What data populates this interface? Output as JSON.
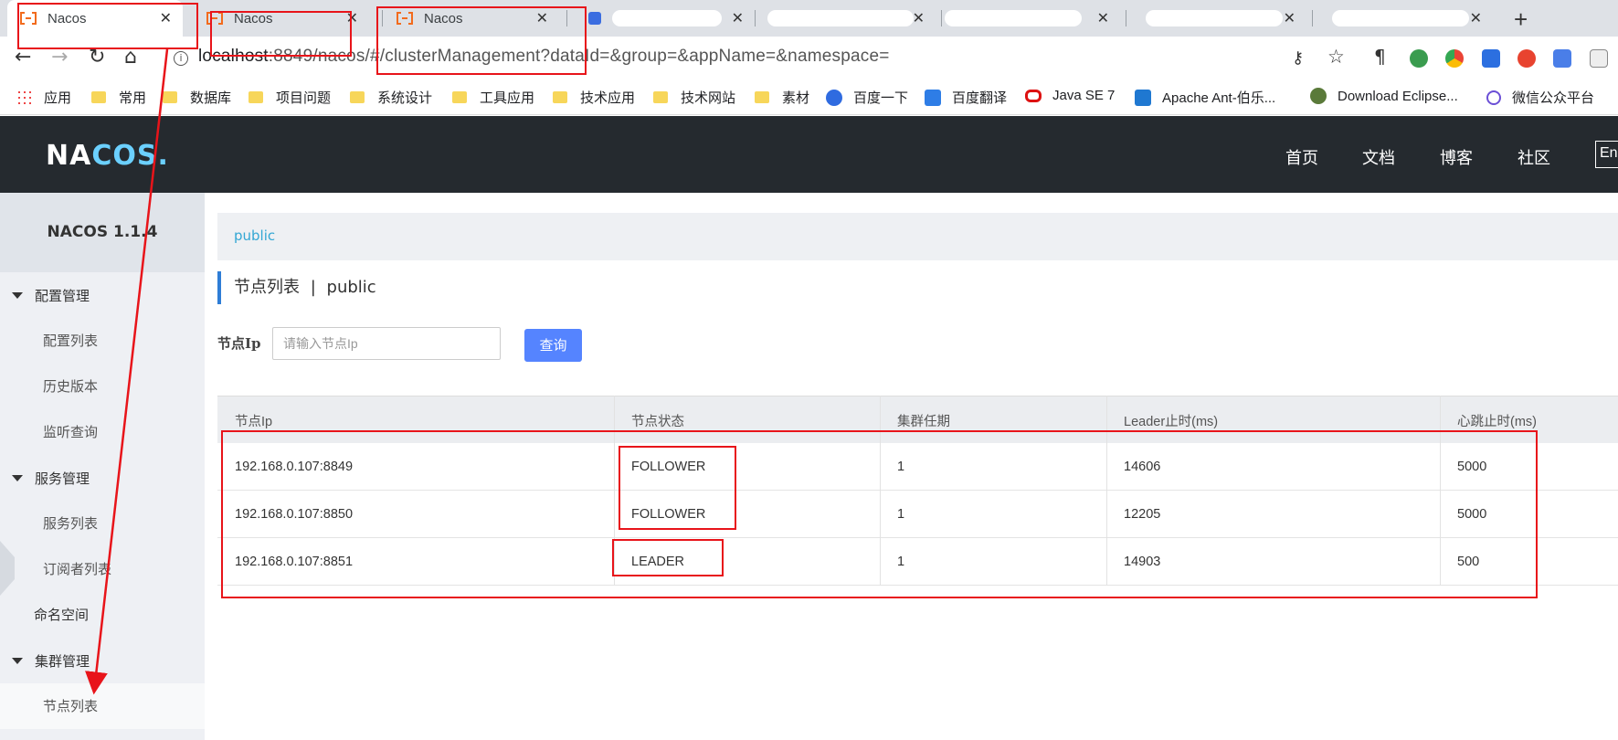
{
  "browser": {
    "tabs": [
      {
        "title": "Nacos",
        "close": "✕"
      },
      {
        "title": "Nacos",
        "close": "✕"
      },
      {
        "title": "Nacos",
        "close": "✕"
      }
    ],
    "new_tab": "+",
    "url_host": "localhost",
    "url_rest": ":8849/nacos/#/clusterManagement?dataId=&group=&appName=&namespace="
  },
  "bookmarks": [
    {
      "label": "应用",
      "icon": "apps-grid-icon"
    },
    {
      "label": "常用",
      "icon": "folder-icon"
    },
    {
      "label": "数据库",
      "icon": "folder-icon"
    },
    {
      "label": "项目问题",
      "icon": "folder-icon"
    },
    {
      "label": "系统设计",
      "icon": "folder-icon"
    },
    {
      "label": "工具应用",
      "icon": "folder-icon"
    },
    {
      "label": "技术应用",
      "icon": "folder-icon"
    },
    {
      "label": "技术网站",
      "icon": "folder-icon"
    },
    {
      "label": "素材",
      "icon": "folder-icon"
    },
    {
      "label": "百度一下",
      "icon": "baidu-icon"
    },
    {
      "label": "百度翻译",
      "icon": "translate-icon"
    },
    {
      "label": "Java SE 7",
      "icon": "oracle-icon"
    },
    {
      "label": "Apache Ant-伯乐...",
      "icon": "blog-icon"
    },
    {
      "label": "Download Eclipse...",
      "icon": "eclipse-icon"
    },
    {
      "label": "微信公众平台",
      "icon": "wechat-icon"
    }
  ],
  "header": {
    "logo_a": "NA",
    "logo_b": "COS",
    "logo_dot": ".",
    "nav": [
      "首页",
      "文档",
      "博客",
      "社区"
    ],
    "lang": "En"
  },
  "sidebar": {
    "version": "NACOS 1.1.4",
    "groups": [
      {
        "label": "配置管理",
        "items": [
          "配置列表",
          "历史版本",
          "监听查询"
        ]
      },
      {
        "label": "服务管理",
        "items": [
          "服务列表",
          "订阅者列表"
        ]
      }
    ],
    "namespace": "命名空间",
    "cluster_group": "集群管理",
    "cluster_item": "节点列表"
  },
  "main": {
    "namespace_tab": "public",
    "title": "节点列表",
    "title_sep": "|",
    "title_ns": "public",
    "search_label": "节点Ip",
    "search_placeholder": "请输入节点Ip",
    "search_button": "查询"
  },
  "table": {
    "columns": [
      "节点Ip",
      "节点状态",
      "集群任期",
      "Leader止时(ms)",
      "心跳止时(ms)"
    ],
    "rows": [
      [
        "192.168.0.107:8849",
        "FOLLOWER",
        "1",
        "14606",
        "5000"
      ],
      [
        "192.168.0.107:8850",
        "FOLLOWER",
        "1",
        "12205",
        "5000"
      ],
      [
        "192.168.0.107:8851",
        "LEADER",
        "1",
        "14903",
        "500"
      ]
    ]
  },
  "colors": {
    "header_bg": "#252a2f",
    "accent_blue": "#5584ff",
    "annotation_red": "#e8141a",
    "namespace_link": "#33a7d4"
  }
}
